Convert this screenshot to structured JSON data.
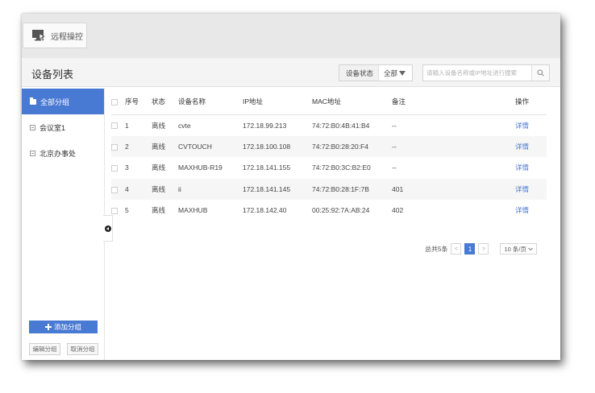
{
  "top_tab": {
    "label": "远程操控"
  },
  "header": {
    "title": "设备列表"
  },
  "filter": {
    "label": "设备状态",
    "value": "全部"
  },
  "search": {
    "placeholder": "请输入设备名称或IP地址进行搜索"
  },
  "sidebar": {
    "items": [
      {
        "label": "全部分组",
        "active": true
      },
      {
        "label": "会议室1",
        "active": false
      },
      {
        "label": "北京办事处",
        "active": false
      }
    ],
    "add_label": "添加分组",
    "edit_label": "编辑分组",
    "cancel_label": "取消分组"
  },
  "table": {
    "headers": [
      "序号",
      "状态",
      "设备名称",
      "IP地址",
      "MAC地址",
      "备注",
      "操作"
    ],
    "rows": [
      {
        "no": "1",
        "status": "离线",
        "name": "cvte",
        "ip": "172.18.99.213",
        "mac": "74:72:B0:4B:41:B4",
        "note": "--",
        "action": "详情"
      },
      {
        "no": "2",
        "status": "离线",
        "name": "CVTOUCH",
        "ip": "172.18.100.108",
        "mac": "74:72:B0:28:20:F4",
        "note": "--",
        "action": "详情"
      },
      {
        "no": "3",
        "status": "离线",
        "name": "MAXHUB-R19",
        "ip": "172.18.141.155",
        "mac": "74:72:B0:3C:B2:E0",
        "note": "--",
        "action": "详情"
      },
      {
        "no": "4",
        "status": "离线",
        "name": "ii",
        "ip": "172.18.141.145",
        "mac": "74:72:B0:28:1F:7B",
        "note": "401",
        "action": "详情"
      },
      {
        "no": "5",
        "status": "离线",
        "name": "MAXHUB",
        "ip": "172.18.142.40",
        "mac": "00:25:92:7A:AB:24",
        "note": "402",
        "action": "详情"
      }
    ]
  },
  "pagination": {
    "total_text": "总共5条",
    "prev": "<",
    "current_page": "1",
    "next": ">",
    "page_size": "10 条/页"
  },
  "colors": {
    "accent": "#4879d3",
    "header_bg": "#f4f4f4",
    "row_alt": "#f6f6f6"
  }
}
